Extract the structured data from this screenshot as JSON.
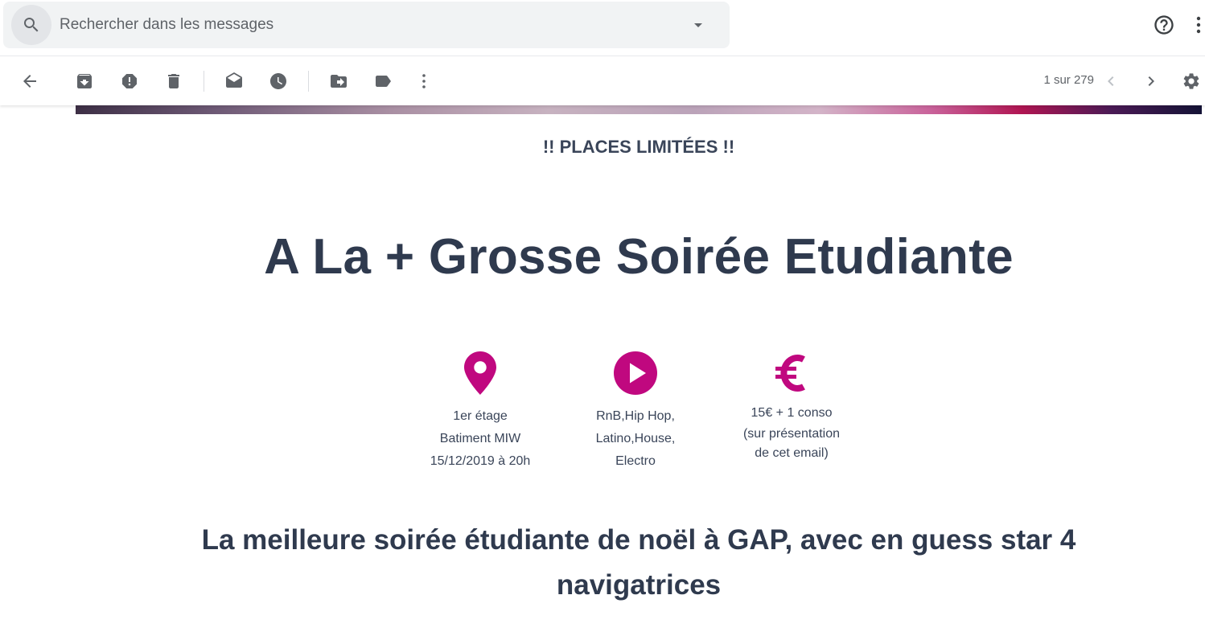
{
  "search": {
    "placeholder": "Rechercher dans les messages",
    "icon": "search-icon",
    "options_icon": "caret-down-icon"
  },
  "top_actions": {
    "help_icon": "help-icon",
    "more_icon": "more-vert-icon"
  },
  "toolbar": {
    "back_icon": "arrow-back-icon",
    "archive_icon": "archive-icon",
    "spam_icon": "report-spam-icon",
    "delete_icon": "delete-icon",
    "mark_unread_icon": "mark-unread-icon",
    "snooze_icon": "snooze-icon",
    "move_icon": "move-to-icon",
    "label_icon": "label-icon",
    "more_icon": "more-vert-icon",
    "pager": "1 sur 279",
    "prev_icon": "chevron-left-icon",
    "next_icon": "chevron-right-icon",
    "settings_icon": "settings-icon"
  },
  "email": {
    "limited": "!! PLACES LIMITÉES !!",
    "headline": "A La + Grosse Soirée Etudiante",
    "info": [
      {
        "icon": "location-pin-icon",
        "lines": [
          "1er étage",
          "Batiment MIW",
          "15/12/2019 à 20h"
        ]
      },
      {
        "icon": "play-circle-icon",
        "lines": [
          "RnB,Hip Hop,",
          "Latino,House,",
          "Electro"
        ]
      },
      {
        "icon": "euro-icon",
        "lines": [
          "15€ + 1 conso",
          "(sur présentation",
          "de cet email)"
        ]
      }
    ],
    "subheadline": "La meilleure soirée étudiante de noël à GAP, avec en guess star 4 navigatrices"
  },
  "colors": {
    "accent": "#c0087f",
    "text": "#3a4559",
    "icon_gray": "#5f6368",
    "search_bg": "#f1f3f4"
  }
}
